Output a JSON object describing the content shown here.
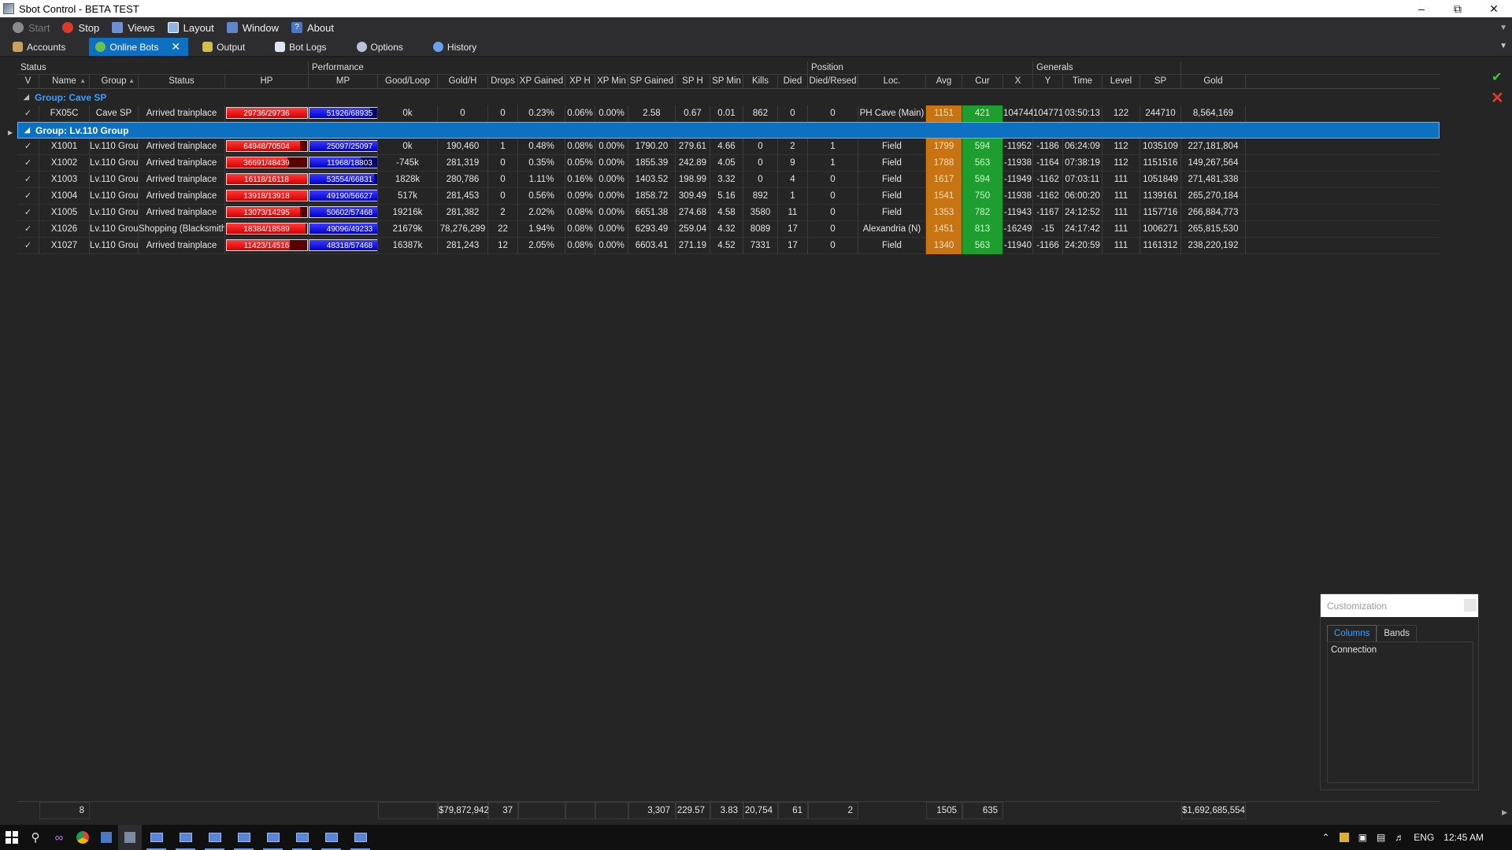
{
  "window": {
    "title": "Sbot Control - BETA TEST"
  },
  "menu": [
    {
      "label": "Start",
      "icon": "play-circle-icon",
      "disabled": true
    },
    {
      "label": "Stop",
      "icon": "stop-icon",
      "disabled": false
    },
    {
      "label": "Views",
      "icon": "views-icon",
      "disabled": false
    },
    {
      "label": "Layout",
      "icon": "layout-icon",
      "disabled": false
    },
    {
      "label": "Window",
      "icon": "window-icon",
      "disabled": false
    },
    {
      "label": "About",
      "icon": "help-icon",
      "disabled": false
    }
  ],
  "tabs": [
    {
      "label": "Accounts",
      "icon": "accounts-icon"
    },
    {
      "label": "Online Bots",
      "icon": "globe-icon",
      "active": true
    },
    {
      "label": "Output",
      "icon": "output-icon"
    },
    {
      "label": "Bot Logs",
      "icon": "logs-icon"
    },
    {
      "label": "Options",
      "icon": "options-gear-icon"
    },
    {
      "label": "History",
      "icon": "history-icon"
    }
  ],
  "bands": [
    {
      "label": "Status",
      "cols": 5
    },
    {
      "label": "Performance",
      "cols": 12
    },
    {
      "label": "Position",
      "cols": 5
    },
    {
      "label": "Generals",
      "cols": 4
    }
  ],
  "columns": [
    "V",
    "Name",
    "Group",
    "Status",
    "HP",
    "MP",
    "Good/Loop",
    "Gold/H",
    "Drops",
    "XP Gained",
    "XP H",
    "XP Min",
    "SP Gained",
    "SP H",
    "SP Min",
    "Kills",
    "Died",
    "Died/Resed",
    "Loc.",
    "Avg",
    "Cur",
    "X",
    "Y",
    "Time",
    "Level",
    "SP",
    "Gold"
  ],
  "groups": [
    {
      "label": "Group: Cave SP",
      "selected": false,
      "rows": [
        [
          "FX05C",
          "Cave SP",
          "Arrived trainplace",
          "29736/29736",
          "51926/68935",
          "0k",
          "0",
          "0",
          "0.23%",
          "0.06%",
          "0.00%",
          "2.58",
          "0.67",
          "0.01",
          "862",
          "0",
          "0",
          "PH Cave (Main)",
          "1151",
          "421",
          "104744",
          "104771",
          "03:50:13",
          "122",
          "244710",
          "8,564,169"
        ]
      ]
    },
    {
      "label": "Group: Lv.110 Group",
      "selected": true,
      "rows": [
        [
          "X1001",
          "Lv.110 Group",
          "Arrived trainplace",
          "64948/70504",
          "25097/25097",
          "0k",
          "190,460",
          "1",
          "0.48%",
          "0.08%",
          "0.00%",
          "1790.20",
          "279.61",
          "4.66",
          "0",
          "2",
          "1",
          "Field",
          "1799",
          "594",
          "-11952",
          "-1186",
          "06:24:09",
          "112",
          "1035109",
          "227,181,804"
        ],
        [
          "X1002",
          "Lv.110 Group",
          "Arrived trainplace",
          "36691/48439",
          "11968/18803",
          "-745k",
          "281,319",
          "0",
          "0.35%",
          "0.05%",
          "0.00%",
          "1855.39",
          "242.89",
          "4.05",
          "0",
          "9",
          "1",
          "Field",
          "1788",
          "563",
          "-11938",
          "-1164",
          "07:38:19",
          "112",
          "1151516",
          "149,267,564"
        ],
        [
          "X1003",
          "Lv.110 Group",
          "Arrived trainplace",
          "16118/16118",
          "53554/66831",
          "1828k",
          "280,786",
          "0",
          "1.11%",
          "0.16%",
          "0.00%",
          "1403.52",
          "198.99",
          "3.32",
          "0",
          "4",
          "0",
          "Field",
          "1617",
          "594",
          "-11949",
          "-1162",
          "07:03:11",
          "111",
          "1051849",
          "271,481,338"
        ],
        [
          "X1004",
          "Lv.110 Group",
          "Arrived trainplace",
          "13918/13918",
          "49190/56627",
          "517k",
          "281,453",
          "0",
          "0.56%",
          "0.09%",
          "0.00%",
          "1858.72",
          "309.49",
          "5.16",
          "892",
          "1",
          "0",
          "Field",
          "1541",
          "750",
          "-11938",
          "-1162",
          "06:00:20",
          "111",
          "1139161",
          "265,270,184"
        ],
        [
          "X1005",
          "Lv.110 Group",
          "Arrived trainplace",
          "13073/14295",
          "50602/57468",
          "19216k",
          "281,382",
          "2",
          "2.02%",
          "0.08%",
          "0.00%",
          "6651.38",
          "274.68",
          "4.58",
          "3580",
          "11",
          "0",
          "Field",
          "1353",
          "782",
          "-11943",
          "-1167",
          "24:12:52",
          "111",
          "1157716",
          "266,884,773"
        ],
        [
          "X1026",
          "Lv.110 Group",
          "Shopping (Blacksmith)",
          "18384/18589",
          "49096/49233",
          "21679k",
          "78,276,299",
          "22",
          "1.94%",
          "0.08%",
          "0.00%",
          "6293.49",
          "259.04",
          "4.32",
          "8089",
          "17",
          "0",
          "Alexandria (N)",
          "1451",
          "813",
          "-16249",
          "-15",
          "24:17:42",
          "111",
          "1006271",
          "265,815,530"
        ],
        [
          "X1027",
          "Lv.110 Group",
          "Arrived trainplace",
          "11423/14516",
          "48318/57468",
          "16387k",
          "281,243",
          "12",
          "2.05%",
          "0.08%",
          "0.00%",
          "6603.41",
          "271.19",
          "4.52",
          "7331",
          "17",
          "0",
          "Field",
          "1340",
          "563",
          "-11940",
          "-1166",
          "24:20:59",
          "111",
          "1161312",
          "238,220,192"
        ]
      ]
    }
  ],
  "footer": {
    "name_count": "8",
    "gold_h": "$79,872,942",
    "drops": "37",
    "sp_gained": "3,307",
    "sp_h": "229.57",
    "sp_min": "3.83",
    "kills": "20,754",
    "died": "61",
    "died_resed": "2",
    "avg": "1505",
    "cur": "635",
    "gold": "$1,692,685,554"
  },
  "customization": {
    "title": "Customization",
    "tabs": [
      "Columns",
      "Bands"
    ],
    "items": [
      "Connection"
    ]
  },
  "taskbar": {
    "language": "ENG",
    "time": "12:45 AM"
  },
  "colors": {
    "accent": "#0e70c0",
    "group_text": "#3aa0ff",
    "avg_cell": "#c87412",
    "cur_cell": "#1f9e30",
    "hp_bar": "#e00000",
    "mp_bar": "#0000dd"
  }
}
